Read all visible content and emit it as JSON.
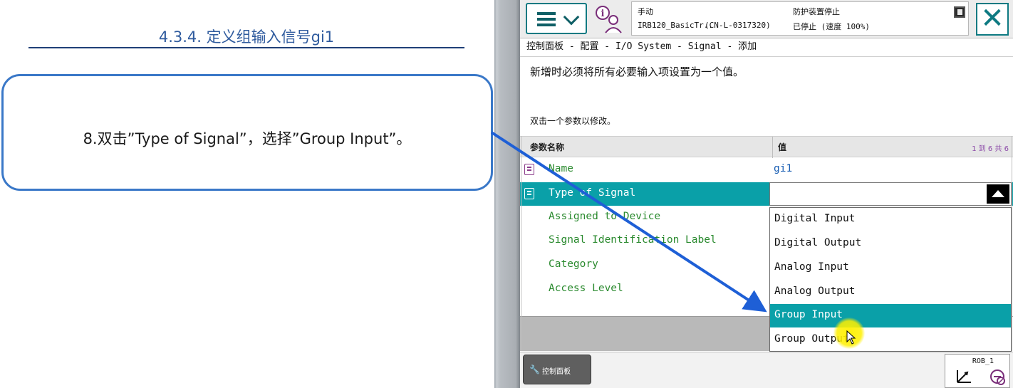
{
  "slide": {
    "title": "4.3.4. 定义组输入信号gi1",
    "instruction": "8.双击”Type of Signal”，选择”Group Input”。"
  },
  "pendant": {
    "status": {
      "mode": "手动",
      "system": "IRB120_BasicTr..",
      "controller": "(CN-L-0317320)",
      "safety": "防护装置停止",
      "state": "已停止 (速度 100%)"
    },
    "breadcrumb": "控制面板 - 配置 - I/O System - Signal - 添加",
    "notice": "新增时必须将所有必要输入项设置为一个值。",
    "hint": "双击一个参数以修改。",
    "table": {
      "col_name": "参数名称",
      "col_value": "值",
      "pager": "1 到 6 共 6",
      "rows": [
        {
          "name": "Name",
          "value": "gi1"
        },
        {
          "name": "Type of Signal",
          "value": ""
        },
        {
          "name": "Assigned to Device",
          "value": ""
        },
        {
          "name": "Signal Identification Label",
          "value": ""
        },
        {
          "name": "Category",
          "value": ""
        },
        {
          "name": "Access Level",
          "value": ""
        }
      ]
    },
    "type_options": [
      "Digital Input",
      "Digital Output",
      "Analog Input",
      "Analog Output",
      "Group Input",
      "Group Output"
    ],
    "selected_option": "Group Input",
    "taskbar": {
      "control_panel": "控制面板"
    },
    "rob_label": "ROB_1"
  },
  "colors": {
    "accent": "#0aa0a8",
    "frame": "#0e7a82",
    "param_name": "#2a8a2e",
    "param_value": "#1a5fb4",
    "callout_border": "#3a78c8",
    "arrow": "#1e5fd6"
  },
  "icons": [
    "menu-icon",
    "chevron-down-icon",
    "operator-info-icon",
    "status-flag-icon",
    "close-icon",
    "parameter-icon",
    "dropdown-up-icon",
    "wrench-icon",
    "coordinate-system-icon",
    "speed-icon",
    "mouse-cursor-icon"
  ]
}
